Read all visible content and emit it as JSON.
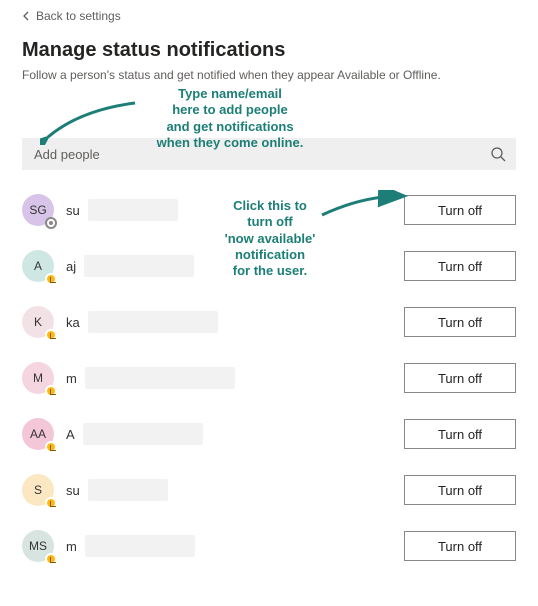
{
  "back_label": "Back to settings",
  "title": "Manage status notifications",
  "subtitle": "Follow a person's status and get notified when they appear Available or Offline.",
  "search": {
    "placeholder": "Add people"
  },
  "turn_off_label": "Turn off",
  "annotations": {
    "add_people": "Type name/email\nhere to add people\nand get notifications\nwhen they come online.",
    "turn_off": "Click this to\nturn off\n'now available'\nnotification\nfor the user."
  },
  "people": [
    {
      "initials": "SG",
      "bg": "#d7c4e8",
      "presence": "offline",
      "frag": "su",
      "blur_w": 90
    },
    {
      "initials": "A",
      "bg": "#cfe7e2",
      "presence": "away",
      "frag": "aj",
      "blur_w": 110
    },
    {
      "initials": "K",
      "bg": "#f2e2e6",
      "presence": "away",
      "frag": "ka",
      "blur_w": 130
    },
    {
      "initials": "M",
      "bg": "#f5d5df",
      "presence": "away",
      "frag": "m",
      "blur_w": 150
    },
    {
      "initials": "AA",
      "bg": "#f3c7d8",
      "presence": "away",
      "frag": "A",
      "blur_w": 120
    },
    {
      "initials": "S",
      "bg": "#fbe7c2",
      "presence": "away",
      "frag": "su",
      "blur_w": 80
    },
    {
      "initials": "MS",
      "bg": "#d7e4e0",
      "presence": "away",
      "frag": "m",
      "blur_w": 110
    }
  ]
}
